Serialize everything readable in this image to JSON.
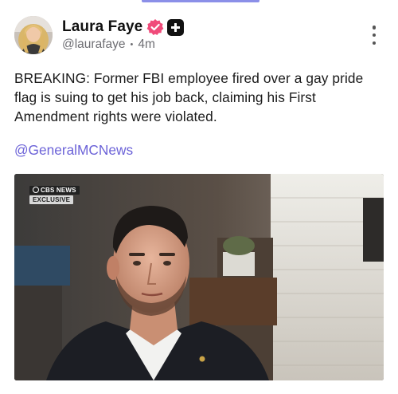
{
  "post": {
    "author": {
      "display_name": "Laura Faye",
      "handle": "@laurafaye",
      "time_ago": "4m",
      "separator": "•",
      "avatar_icon": "avatar-photo",
      "verified_icon": "verified-badge-icon",
      "plus_icon": "plus-badge-icon"
    },
    "menu_icon": "more-vertical-icon",
    "text": "BREAKING: Former FBI employee fired over a gay pride flag is suing to get his job back, claiming his First Amendment rights were violated.",
    "mention": "@GeneralMCNews",
    "media": {
      "watermark_line1": "CBS NEWS",
      "watermark_line2": "EXCLUSIVE"
    }
  },
  "colors": {
    "accent": "#6c63d8",
    "verified": "#f04b7a",
    "top_rule": "#8b8fe8"
  }
}
